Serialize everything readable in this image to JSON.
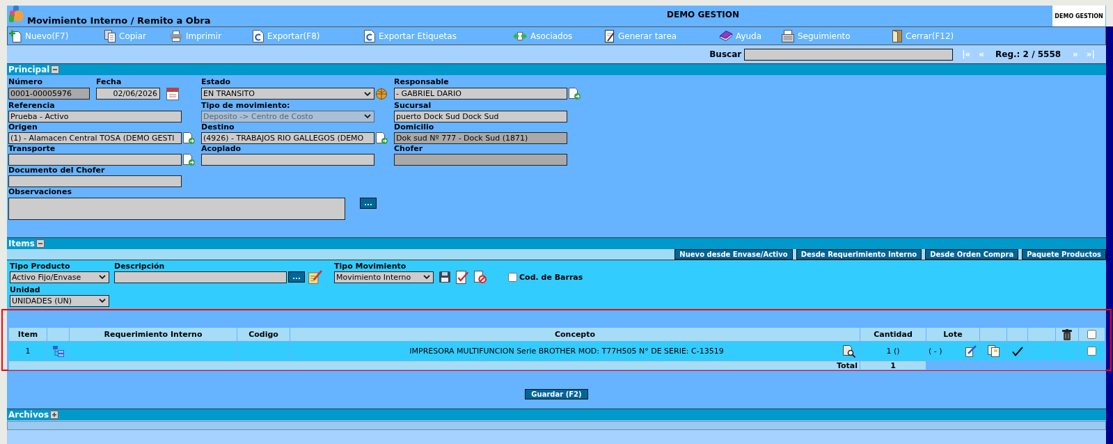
{
  "header": {
    "title": "Movimiento Interno / Remito a Obra",
    "company": "DEMO GESTION",
    "logo_text": "DEMO GESTION"
  },
  "toolbar": [
    {
      "label": "Nuevo(F7)"
    },
    {
      "label": "Copiar"
    },
    {
      "label": "Imprimir"
    },
    {
      "label": "Exportar(F8)"
    },
    {
      "label": "Exportar Etiquetas"
    },
    {
      "label": "Asociados"
    },
    {
      "label": "Generar tarea"
    },
    {
      "label": "Ayuda"
    },
    {
      "label": "Seguimiento"
    },
    {
      "label": "Cerrar(F12)"
    }
  ],
  "search": {
    "label": "Buscar",
    "first": "|«",
    "previous": "«",
    "record": "Reg.: 2 / 5558",
    "next": "»",
    "last": "»|"
  },
  "principal": {
    "title": "Principal",
    "expanded": true,
    "rows": [
      [
        [
          {
            "kind": "text",
            "label": "Número",
            "value": "0001-00005976",
            "readonly": true
          },
          {
            "kind": "date",
            "label": "Fecha",
            "value": "02/06/2026",
            "readonly": false
          }
        ],
        [
          {
            "kind": "selectlookup",
            "label": "Estado",
            "value": "EN TRANSITO",
            "readonly": false
          }
        ],
        [
          {
            "kind": "lookup",
            "label": "Responsable",
            "value": "- GABRIEL DARIO",
            "readonly": false
          }
        ]
      ],
      [
        [
          {
            "kind": "text",
            "label": "Referencia",
            "value": "Prueba - Activo",
            "readonly": false
          }
        ],
        [
          {
            "kind": "select",
            "label": "Tipo de movimiento:",
            "value": "Deposito -> Centro de Costo",
            "readonly": true
          }
        ],
        [
          {
            "kind": "text",
            "label": "Sucursal",
            "value": "puerto Dock Sud Dock Sud",
            "readonly": false
          }
        ]
      ],
      [
        [
          {
            "kind": "lookup",
            "label": "Origen",
            "value": "(1) - Alamacen Central TOSA (DEMO GESTI",
            "readonly": false
          }
        ],
        [
          {
            "kind": "lookup",
            "label": "Destino",
            "value": "(4926) - TRABAJOS RIO GALLEGOS (DEMO",
            "readonly": false
          }
        ],
        [
          {
            "kind": "text",
            "label": "Domicilio",
            "value": "Dok sud Nº 777 - Dock Sud (1871)",
            "readonly": true
          }
        ]
      ],
      [
        [
          {
            "kind": "lookup",
            "label": "Transporte",
            "readonly": false
          }
        ],
        [
          {
            "kind": "text",
            "label": "Acoplado",
            "readonly": false
          }
        ],
        [
          {
            "kind": "text",
            "label": "Chofer",
            "readonly": true
          }
        ]
      ],
      [
        [
          {
            "kind": "text",
            "label": "Documento del Chofer",
            "readonly": false
          }
        ]
      ],
      [
        [
          {
            "kind": "memo",
            "label": "Observaciones",
            "button": "...",
            "readonly": false
          }
        ]
      ]
    ]
  },
  "items": {
    "title": "Items",
    "expanded": true,
    "actions": [
      "Nuevo desde Envase/Activo",
      "Desde Requerimiento Interno",
      "Desde Orden Compra",
      "Paquete Productos"
    ],
    "filter_rows": [
      [
        {
          "kind": "select",
          "label": "Tipo Producto",
          "value": "Activo Fijo/Envase"
        },
        {
          "kind": "search",
          "label": "Descripción",
          "button": "..."
        },
        {
          "kind": "selecttools",
          "label": "Tipo Movimiento",
          "value": "Movimiento Interno"
        },
        {
          "kind": "checkbox",
          "label": "Cod. de Barras",
          "checked": false
        }
      ],
      [
        {
          "kind": "select",
          "label": "Unidad",
          "value": "UNIDADES (UN)"
        }
      ]
    ]
  },
  "table": {
    "highlighted": true,
    "columns": [
      {
        "kind": "text",
        "label": "Item"
      },
      {
        "kind": "blank"
      },
      {
        "kind": "text",
        "label": "Requerimiento Interno"
      },
      {
        "kind": "text",
        "label": "Codigo"
      },
      {
        "kind": "text",
        "label": "Concepto"
      },
      {
        "kind": "text",
        "label": "Cantidad"
      },
      {
        "kind": "text",
        "label": "Lote"
      },
      {
        "kind": "blank"
      },
      {
        "kind": "blank"
      },
      {
        "kind": "blank"
      },
      {
        "kind": "trash"
      },
      {
        "kind": "checkbox",
        "checked": false
      }
    ],
    "rows": [
      {
        "item": "1",
        "concept": "IMPRESORA MULTIFUNCION Serie BROTHER MOD: T77H505 N° DE SERIE: C-13519",
        "quantity": "1 ()",
        "lot": "( - )",
        "confirmed": true,
        "selected": false
      }
    ],
    "total_label": "Total",
    "total": "1"
  },
  "save_button": "Guardar (F2)",
  "files": {
    "title": "Archivos",
    "expanded": false
  }
}
